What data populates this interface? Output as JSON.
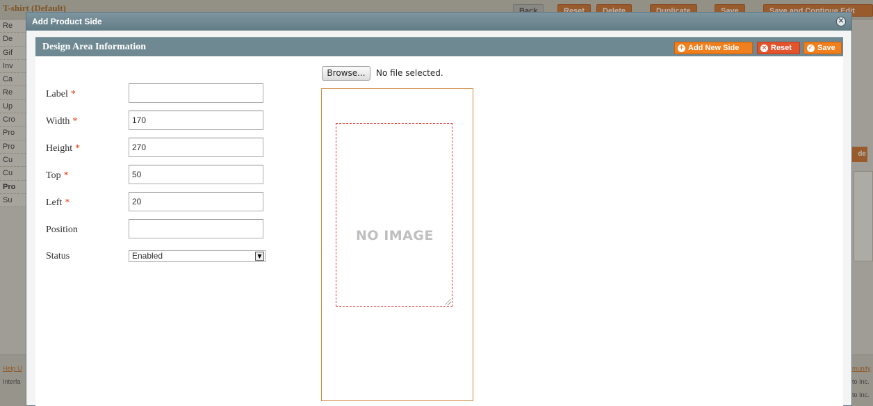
{
  "background": {
    "page_title": "T-shirt (Default)",
    "header_buttons": [
      "Back",
      "Reset",
      "Delete",
      "Duplicate",
      "Save",
      "Save and Continue Edit"
    ],
    "sidebar_tabs": [
      "Re",
      "De",
      "Gif",
      "Inv",
      "Ca",
      "Re",
      "Up",
      "Cro",
      "Pro",
      "Pro",
      "Cu",
      "Cu",
      "Pro",
      "Su"
    ],
    "right_button": "de",
    "footer_help": "Help U",
    "footer_interface": "Interfa",
    "footer_community": "munity",
    "footer_inc1": "to Inc.",
    "footer_inc2": "to Inc."
  },
  "modal": {
    "title": "Add Product Side",
    "close_icon": "close-circle-icon"
  },
  "section": {
    "title": "Design Area Information",
    "add_new_side": "Add New Side",
    "reset": "Reset",
    "save": "Save"
  },
  "form": {
    "label": {
      "label": "Label",
      "value": ""
    },
    "width": {
      "label": "Width",
      "value": "170"
    },
    "height": {
      "label": "Height",
      "value": "270"
    },
    "top": {
      "label": "Top",
      "value": "50"
    },
    "left": {
      "label": "Left",
      "value": "20"
    },
    "position": {
      "label": "Position",
      "value": ""
    },
    "status": {
      "label": "Status",
      "value": "Enabled"
    },
    "required_marker": "*"
  },
  "file": {
    "browse_label": "Browse...",
    "status": "No file selected."
  },
  "preview": {
    "placeholder_text": "NO IMAGE",
    "frame_color": "#d08a40",
    "design_area_border_color": "#e8393c"
  }
}
